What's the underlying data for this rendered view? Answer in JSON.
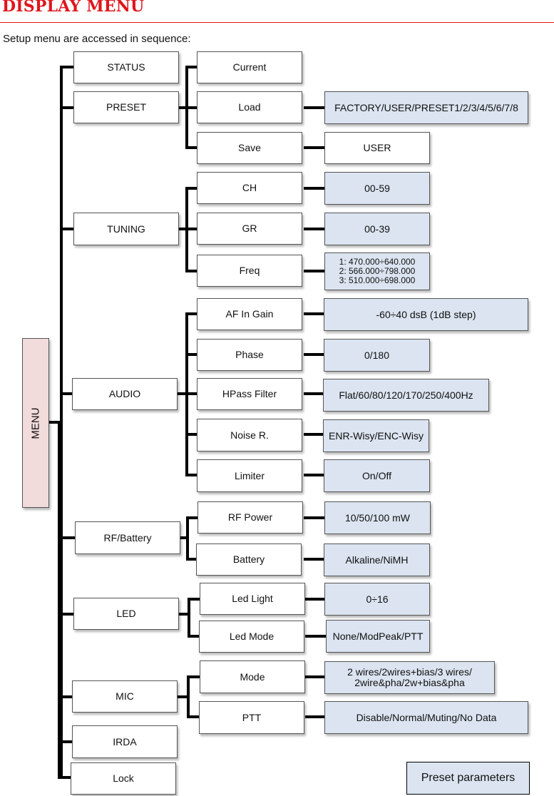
{
  "header": {
    "title": "DISPLAY MENU",
    "subtitle": "Setup menu are accessed in sequence:"
  },
  "root": {
    "label": "MENU"
  },
  "menu": [
    {
      "label": "STATUS",
      "children": [
        {
          "label": "Current"
        }
      ]
    },
    {
      "label": "PRESET",
      "children": [
        {
          "label": "Load",
          "value": "FACTORY/USER/PRESET1/2/3/4/5/6/7/8"
        },
        {
          "label": "Save",
          "value": "USER"
        }
      ]
    },
    {
      "label": "TUNING",
      "children": [
        {
          "label": "CH",
          "value": "00-59"
        },
        {
          "label": "GR",
          "value": "00-39"
        },
        {
          "label": "Freq",
          "value_lines": [
            "1: 470.000÷640.000",
            "2: 566.000÷798.000",
            "3: 510.000÷698.000"
          ]
        }
      ]
    },
    {
      "label": "AUDIO",
      "children": [
        {
          "label": "AF In Gain",
          "value": "-60÷40 dsB (1dB step)"
        },
        {
          "label": "Phase",
          "value": "0/180"
        },
        {
          "label": "HPass Filter",
          "value": "Flat/60/80/120/170/250/400Hz"
        },
        {
          "label": "Noise R.",
          "value": "ENR-Wisy/ENC-Wisy"
        },
        {
          "label": "Limiter",
          "value": "On/Off"
        }
      ]
    },
    {
      "label": "RF/Battery",
      "children": [
        {
          "label": "RF Power",
          "value": "10/50/100 mW"
        },
        {
          "label": "Battery",
          "value": "Alkaline/NiMH"
        }
      ]
    },
    {
      "label": "LED",
      "children": [
        {
          "label": "Led Light",
          "value": "0÷16"
        },
        {
          "label": "Led Mode",
          "value": "None/ModPeak/PTT"
        }
      ]
    },
    {
      "label": "MIC",
      "children": [
        {
          "label": "Mode",
          "value_lines": [
            "2 wires/2wires+bias/3 wires/",
            "2wire&pha/2w+bias&pha"
          ]
        },
        {
          "label": "PTT",
          "value": "Disable/Normal/Muting/No Data"
        }
      ]
    },
    {
      "label": "IRDA",
      "children": []
    },
    {
      "label": "Lock",
      "children": []
    }
  ],
  "legend": {
    "label": "Preset parameters",
    "color": "#dbe4f0"
  },
  "colors": {
    "title": "#e0161d",
    "value_fill": "#dbe4f0",
    "root_fill": "#f2dbdb"
  }
}
